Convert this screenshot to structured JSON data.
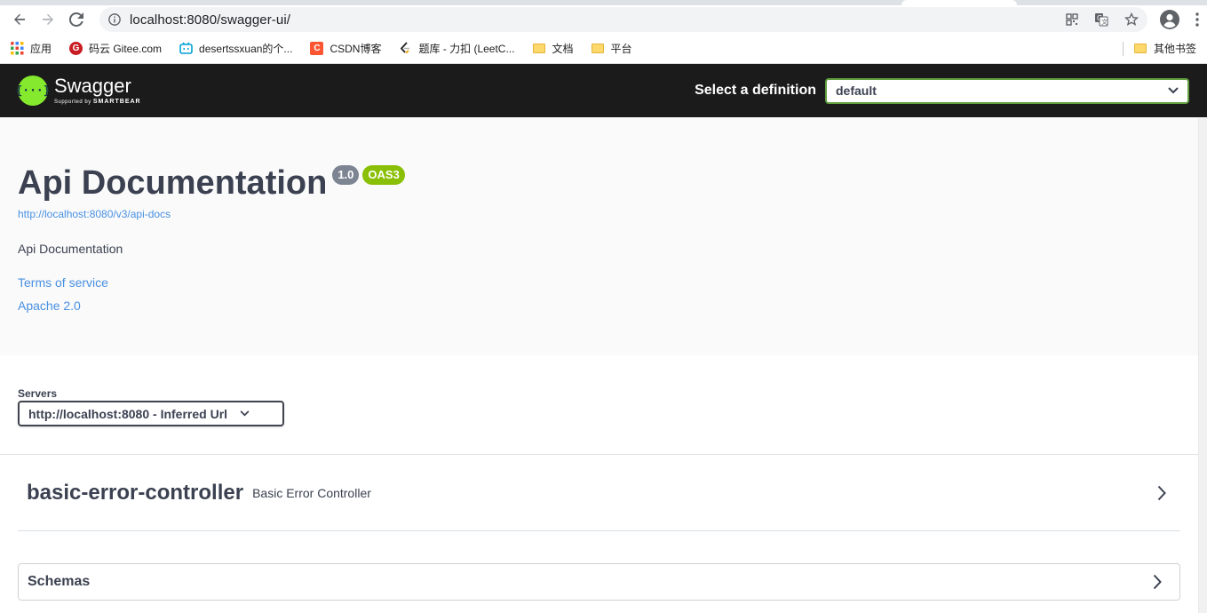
{
  "browser": {
    "url": "localhost:8080/swagger-ui/",
    "bookmarks": [
      {
        "label": "应用",
        "icon": "apps-grid-icon"
      },
      {
        "label": "码云 Gitee.com",
        "icon": "gitee-icon",
        "color": "#c71d23"
      },
      {
        "label": "desertssxuan的个...",
        "icon": "bilibili-icon",
        "color": "#00a1d6"
      },
      {
        "label": "CSDN博客",
        "icon": "csdn-icon",
        "color": "#fc5531"
      },
      {
        "label": "题库 - 力扣 (LeetC...",
        "icon": "leetcode-icon"
      },
      {
        "label": "文档",
        "icon": "folder-icon"
      },
      {
        "label": "平台",
        "icon": "folder-icon"
      }
    ],
    "other_bookmarks": "其他书签"
  },
  "swagger": {
    "brand": "Swagger",
    "supported_by": "Supported by",
    "smartbear": "SMARTBEAR",
    "select_definition_label": "Select a definition",
    "definition_value": "default",
    "accent": "#85ea2d"
  },
  "info": {
    "title": "Api Documentation",
    "version": "1.0",
    "oas_badge": "OAS3",
    "docs_url": "http://localhost:8080/v3/api-docs",
    "description": "Api Documentation",
    "terms_link": "Terms of service",
    "license_link": "Apache 2.0"
  },
  "servers": {
    "label": "Servers",
    "selected": "http://localhost:8080 - Inferred Url"
  },
  "tags": [
    {
      "name": "basic-error-controller",
      "description": "Basic Error Controller"
    }
  ],
  "schemas": {
    "label": "Schemas"
  }
}
